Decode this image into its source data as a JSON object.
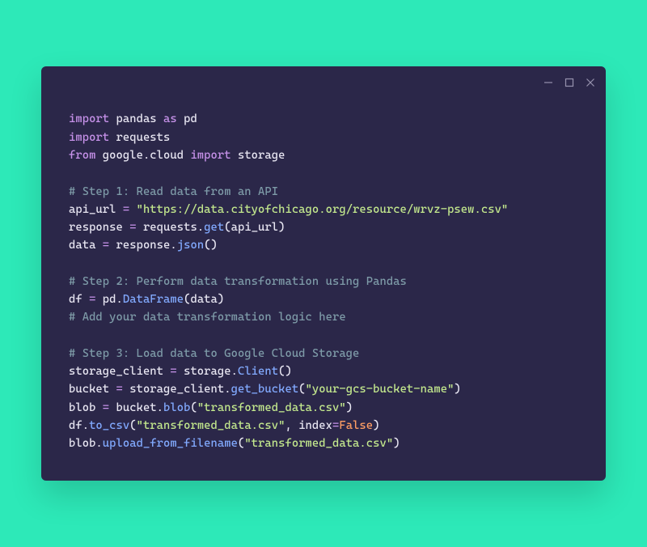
{
  "code": {
    "l1": {
      "kw1": "import",
      "id1": "pandas",
      "kw2": "as",
      "id2": "pd"
    },
    "l2": {
      "kw1": "import",
      "id1": "requests"
    },
    "l3": {
      "kw1": "from",
      "id1": "google.cloud",
      "kw2": "import",
      "id2": "storage"
    },
    "l5": {
      "cm": "# Step 1: Read data from an API"
    },
    "l6": {
      "id1": "api_url ",
      "op": "=",
      "str": " \"https://data.cityofchicago.org/resource/wrvz-psew.csv\""
    },
    "l7": {
      "id1": "response ",
      "op": "=",
      "id2": " requests.",
      "fn": "get",
      "id3": "(api_url)"
    },
    "l8": {
      "id1": "data ",
      "op": "=",
      "id2": " response.",
      "fn": "json",
      "id3": "()"
    },
    "l10": {
      "cm": "# Step 2: Perform data transformation using Pandas"
    },
    "l11": {
      "id1": "df ",
      "op": "=",
      "id2": " pd.",
      "fn": "DataFrame",
      "id3": "(data)"
    },
    "l12": {
      "cm": "# Add your data transformation logic here"
    },
    "l14": {
      "cm": "# Step 3: Load data to Google Cloud Storage"
    },
    "l15": {
      "id1": "storage_client ",
      "op": "=",
      "id2": " storage.",
      "fn": "Client",
      "id3": "()"
    },
    "l16": {
      "id1": "bucket ",
      "op": "=",
      "id2": " storage_client.",
      "fn": "get_bucket",
      "id3": "(",
      "str": "\"your-gcs-bucket-name\"",
      "id4": ")"
    },
    "l17": {
      "id1": "blob ",
      "op": "=",
      "id2": " bucket.",
      "fn": "blob",
      "id3": "(",
      "str": "\"transformed_data.csv\"",
      "id4": ")"
    },
    "l18": {
      "id1": "df.",
      "fn": "to_csv",
      "id2": "(",
      "str": "\"transformed_data.csv\"",
      "id3": ", index",
      "op": "=",
      "bool": "False",
      "id4": ")"
    },
    "l19": {
      "id1": "blob.",
      "fn": "upload_from_filename",
      "id2": "(",
      "str": "\"transformed_data.csv\"",
      "id3": ")"
    }
  }
}
